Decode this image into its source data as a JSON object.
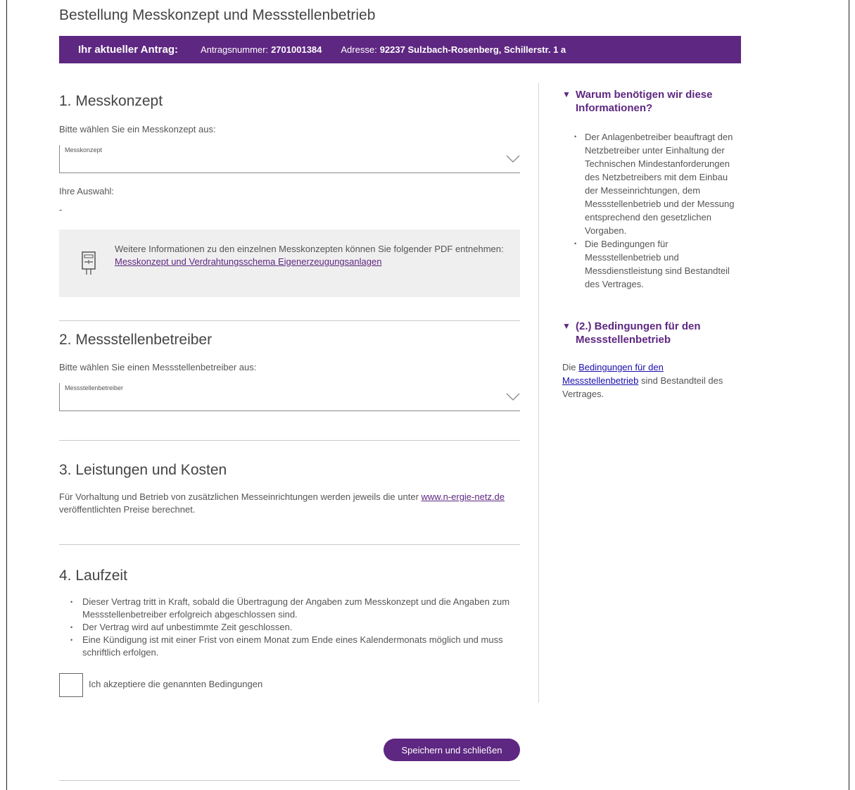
{
  "page_title": "Bestellung Messkonzept und Messstellenbetrieb",
  "antrag": {
    "lead": "Ihr aktueller Antrag:",
    "nummer_label": "Antragsnummer:",
    "nummer_value": "2701001384",
    "adresse_label": "Adresse:",
    "adresse_value": "92237 Sulzbach-Rosenberg, Schillerstr. 1 a"
  },
  "section1": {
    "title": "1. Messkonzept",
    "prompt": "Bitte wählen Sie ein Messkonzept aus:",
    "select_label": "Messkonzept",
    "selection_label": "Ihre Auswahl:",
    "selection_value": "-",
    "info_text": "Weitere Informationen zu den einzelnen Messkonzepten können Sie folgender PDF entnehmen:",
    "info_link": "Messkonzept und Verdrahtungsschema Eigenerzeugungsanlagen"
  },
  "section2": {
    "title": "2. Messstellenbetreiber",
    "prompt": "Bitte wählen Sie einen Messstellenbetreiber aus:",
    "select_label": "Messstellenbetreiber"
  },
  "section3": {
    "title": "3. Leistungen und Kosten",
    "text_before": "Für Vorhaltung und Betrieb von zusätzlichen Messeinrichtungen werden jeweils die unter ",
    "link": "www.n-ergie-netz.de",
    "text_after": " veröffentlichten Preise berechnet."
  },
  "section4": {
    "title": "4. Laufzeit",
    "bullets": [
      "Dieser Vertrag tritt in Kraft, sobald die Übertragung der Angaben zum Messkonzept und die Angaben zum Messstellenbetreiber erfolgreich abgeschlossen sind.",
      "Der Vertrag wird auf unbestimmte Zeit geschlossen.",
      "Eine Kündigung ist mit einer Frist von einem Monat zum Ende eines Kalendermonats möglich und muss schriftlich erfolgen."
    ],
    "checkbox_label": "Ich akzeptiere die genannten Bedingungen"
  },
  "save_button": "Speichern und schließen",
  "sidebar": {
    "panel1_title": "Warum benötigen wir diese Informationen?",
    "panel1_bullets": [
      "Der Anlagenbetreiber beauftragt den Netzbetreiber unter Einhaltung der Technischen Mindestanforderungen des Netzbetreibers mit dem Einbau der Messeinrichtungen, dem Messstellenbetrieb und der Messung entsprechend den gesetzlichen Vorgaben.",
      "Die Bedingungen für Messstellenbetrieb und Messdienstleistung sind Bestandteil des Vertrages."
    ],
    "panel2_title": "(2.) Bedingungen für den Messstellenbetrieb",
    "panel2_before": "Die ",
    "panel2_link": "Bedingungen für den Messstellenbetrieb",
    "panel2_after": " sind Bestandteil des Vertrages.",
    "triangle_icon": "▼"
  },
  "colors": {
    "brand": "#5e2781",
    "divider": "#c9c9c9",
    "infobox": "#efefef"
  }
}
